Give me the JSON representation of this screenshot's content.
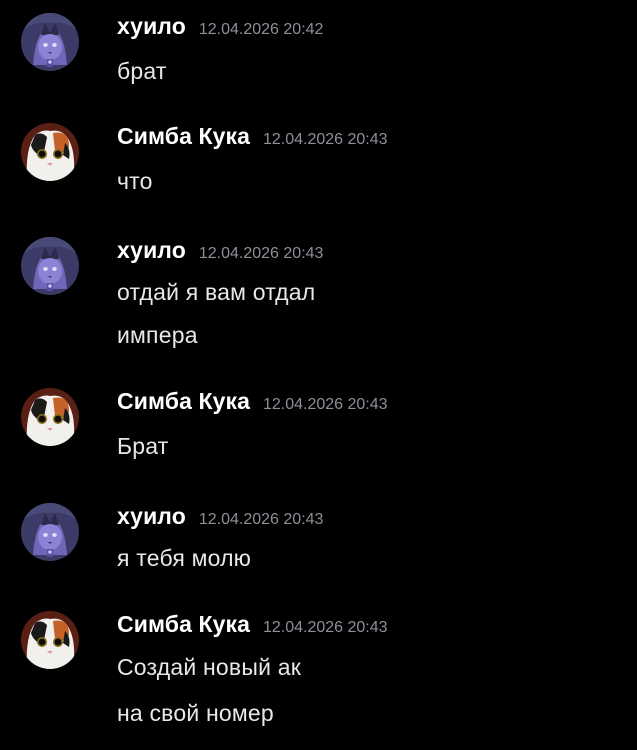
{
  "colors": {
    "background": "#000000",
    "username": "#ffffff",
    "timestamp": "#8e9099",
    "message": "#e8e8ea"
  },
  "messages": [
    {
      "author": "хуило",
      "avatar": "purple-cat-avatar-icon",
      "timestamp": "12.04.2026 20:42",
      "lines": [
        "брат"
      ]
    },
    {
      "author": "Симба Кука",
      "avatar": "calico-cat-avatar-icon",
      "timestamp": "12.04.2026 20:43",
      "lines": [
        "что"
      ]
    },
    {
      "author": "хуило",
      "avatar": "purple-cat-avatar-icon",
      "timestamp": "12.04.2026 20:43",
      "lines": [
        "отдай я вам отдал",
        "импера"
      ]
    },
    {
      "author": "Симба Кука",
      "avatar": "calico-cat-avatar-icon",
      "timestamp": "12.04.2026 20:43",
      "lines": [
        "Брат"
      ]
    },
    {
      "author": "хуило",
      "avatar": "purple-cat-avatar-icon",
      "timestamp": "12.04.2026 20:43",
      "lines": [
        "я тебя молю"
      ]
    },
    {
      "author": "Симба Кука",
      "avatar": "calico-cat-avatar-icon",
      "timestamp": "12.04.2026 20:43",
      "lines": [
        "Создай новый ак",
        "на свой номер"
      ]
    }
  ]
}
